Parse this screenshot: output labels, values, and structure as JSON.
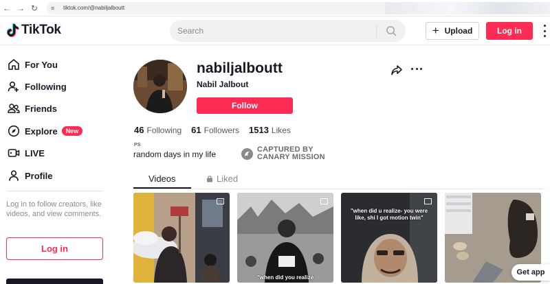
{
  "browser": {
    "url": "tiktok.com/@nabiljalboutt"
  },
  "header": {
    "brand": "TikTok",
    "search_placeholder": "Search",
    "upload_label": "Upload",
    "login_label": "Log in"
  },
  "sidebar": {
    "items": [
      {
        "label": "For You",
        "icon": "home-icon"
      },
      {
        "label": "Following",
        "icon": "following-icon"
      },
      {
        "label": "Friends",
        "icon": "friends-icon"
      },
      {
        "label": "Explore",
        "icon": "explore-icon",
        "badge": "New"
      },
      {
        "label": "LIVE",
        "icon": "live-icon"
      },
      {
        "label": "Profile",
        "icon": "profile-icon"
      }
    ],
    "login_hint": "Log in to follow creators, like videos, and view comments.",
    "login_button": "Log in"
  },
  "profile": {
    "username": "nabiljalboutt",
    "nickname": "Nabil Jalbout",
    "follow_label": "Follow",
    "stats": [
      {
        "value": "46",
        "label": "Following"
      },
      {
        "value": "61",
        "label": "Followers"
      },
      {
        "value": "1513",
        "label": "Likes"
      }
    ],
    "ps": "PS",
    "bio": "random days in my life",
    "captured_line1": "CAPTURED BY",
    "captured_line2": "CANARY MISSION"
  },
  "tabs": {
    "videos": "Videos",
    "liked": "Liked"
  },
  "videos": [
    {
      "caption": ""
    },
    {
      "caption": "\"when did you realize"
    },
    {
      "caption": "\"when did u realize- you were like, shi I got motion twin\""
    },
    {
      "caption": ""
    }
  ],
  "get_app": "Get app",
  "colors": {
    "accent": "#fe2c55",
    "text": "#161823",
    "muted": "#8a8b91"
  }
}
